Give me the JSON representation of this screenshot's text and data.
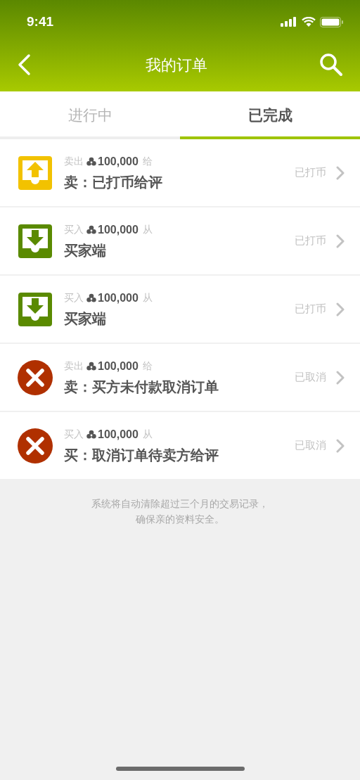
{
  "status_bar": {
    "time": "9:41"
  },
  "header": {
    "title": "我的订单"
  },
  "tabs": [
    {
      "label": "进行中",
      "selected": false
    },
    {
      "label": "已完成",
      "selected": true
    }
  ],
  "orders": [
    {
      "kind": "sell",
      "direction": "卖出",
      "amount": "100,000",
      "preposition": "给",
      "title": "卖：已打币给评",
      "status": "已打币"
    },
    {
      "kind": "buy",
      "direction": "买入",
      "amount": "100,000",
      "preposition": "从",
      "title": "买家端",
      "status": "已打币"
    },
    {
      "kind": "buy",
      "direction": "买入",
      "amount": "100,000",
      "preposition": "从",
      "title": "买家端",
      "status": "已打币"
    },
    {
      "kind": "cancel",
      "direction": "卖出",
      "amount": "100,000",
      "preposition": "给",
      "title": "卖：买方未付款取消订单",
      "status": "已取消"
    },
    {
      "kind": "cancel",
      "direction": "买入",
      "amount": "100,000",
      "preposition": "从",
      "title": "买：取消订单待卖方给评",
      "status": "已取消"
    }
  ],
  "footer_note": {
    "lines": [
      "系统将自动清除超过三个月的交易记录，",
      "确保亲的资料安全。"
    ]
  }
}
